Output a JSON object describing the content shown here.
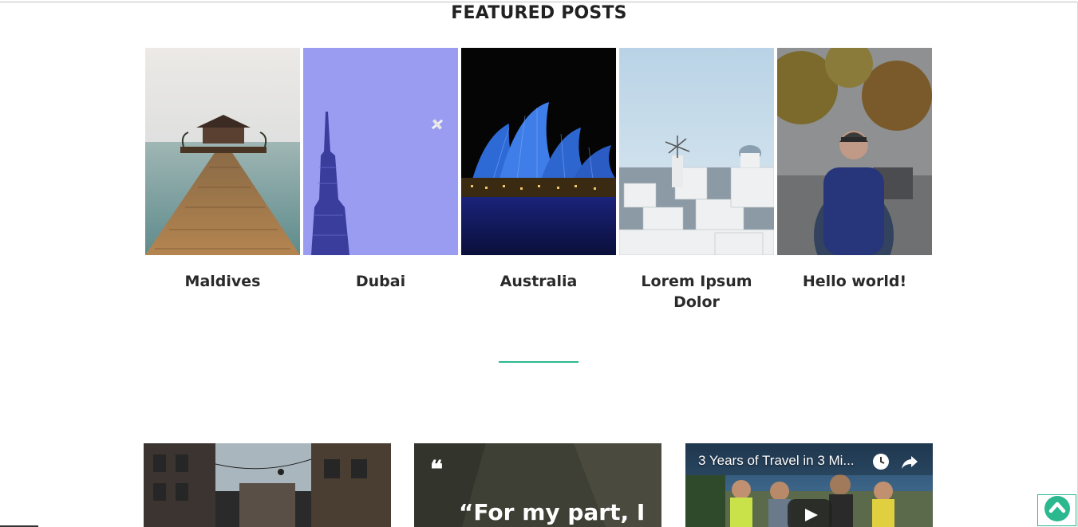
{
  "section": {
    "title": "FEATURED POSTS"
  },
  "featured": [
    {
      "title": "Maldives"
    },
    {
      "title": "Dubai"
    },
    {
      "title": "Australia"
    },
    {
      "title": "Lorem Ipsum Dolor"
    },
    {
      "title": "Hello world!"
    }
  ],
  "posts": {
    "quote": {
      "mark": "❝",
      "text": "“For my part, I"
    },
    "video": {
      "title": "3 Years of Travel in 3 Mi..."
    }
  },
  "colors": {
    "accent": "#2bb88f",
    "title_text": "#222222"
  },
  "icons": {
    "scroll_top": "chevron-up-circle-icon",
    "video_clock": "clock-icon",
    "video_share": "share-icon",
    "video_play": "play-icon"
  }
}
